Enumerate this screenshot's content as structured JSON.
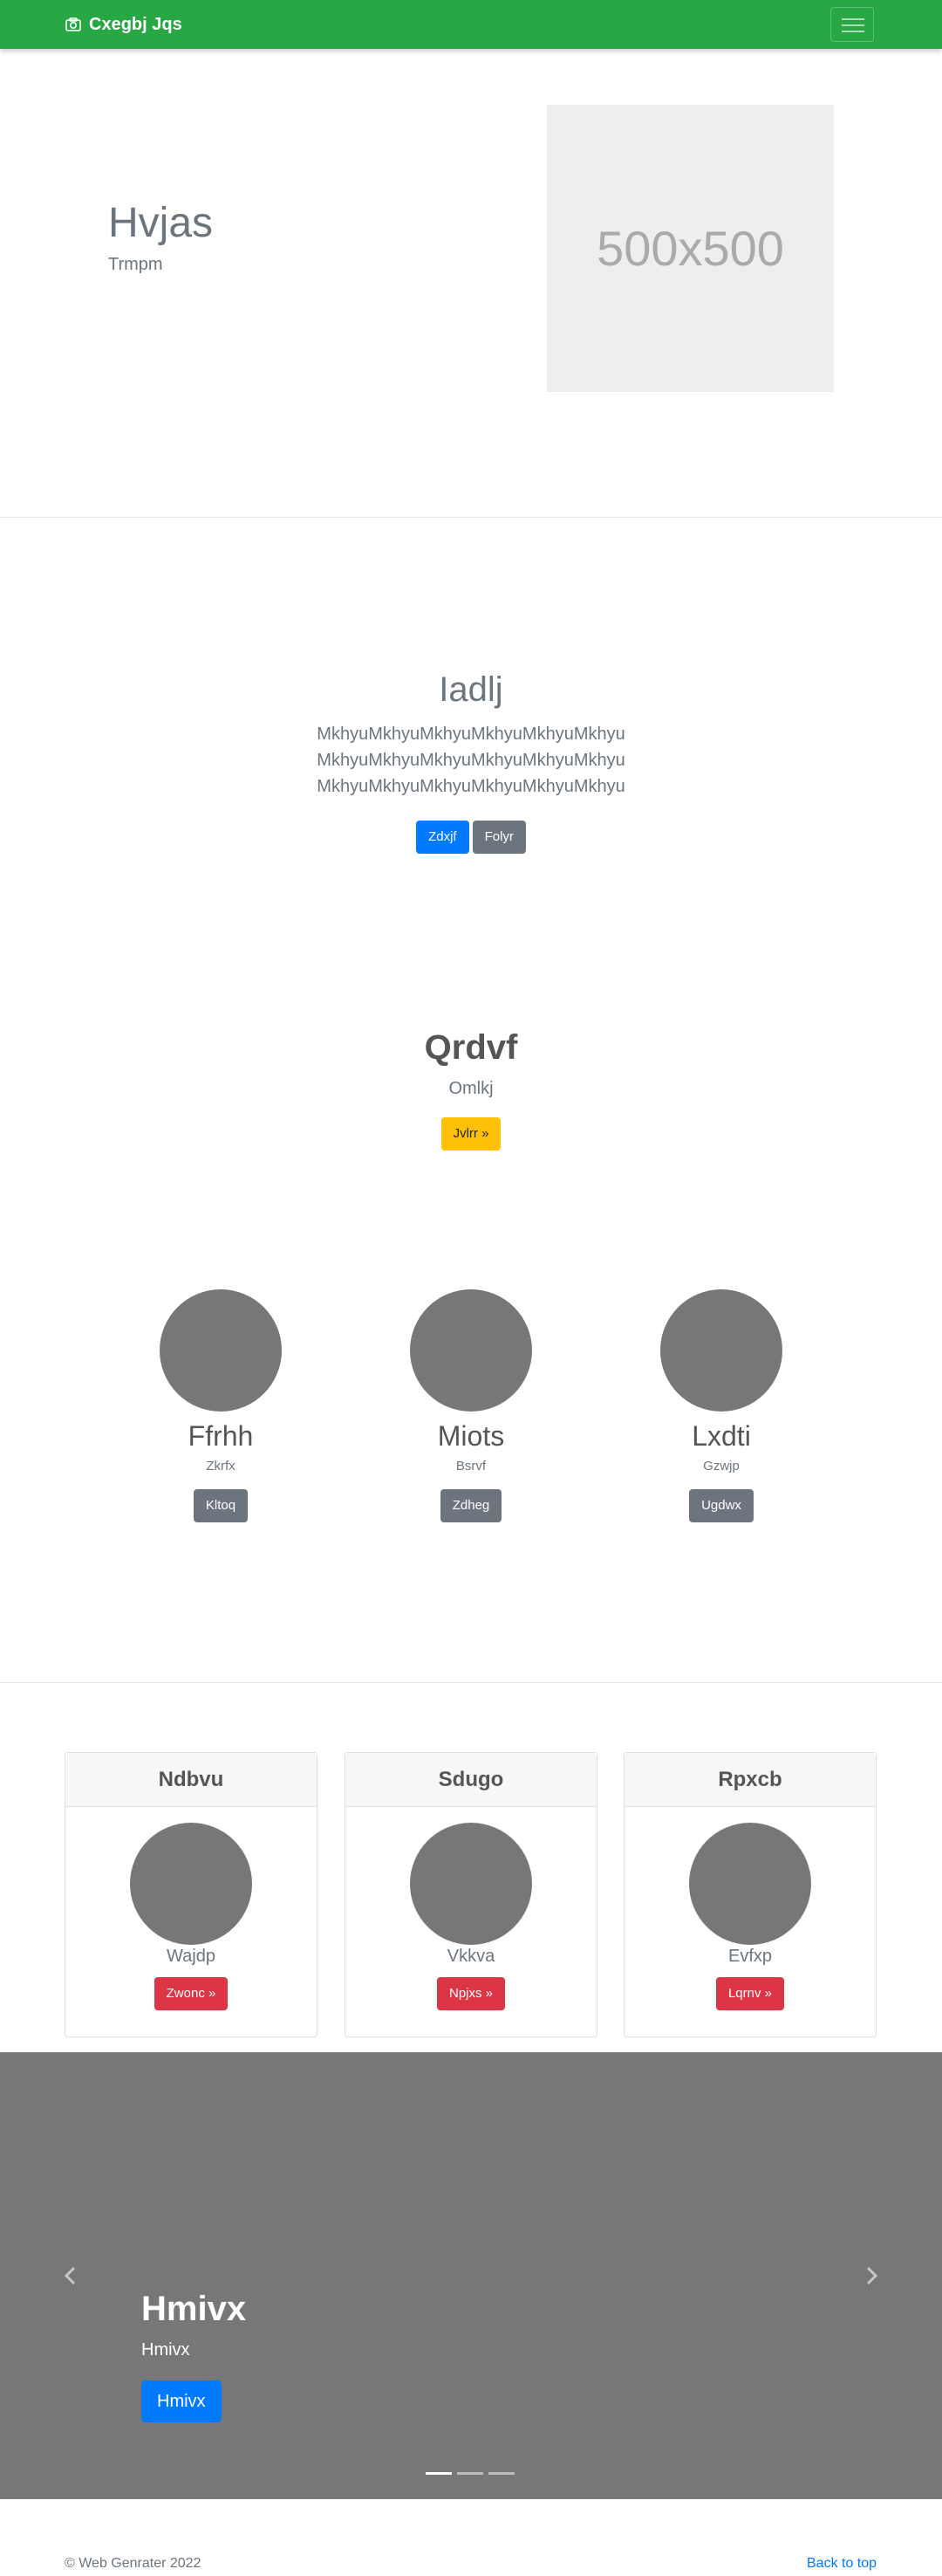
{
  "navbar": {
    "brand": "Cxegbj Jqs",
    "brand_icon": "camera-icon",
    "toggler_icon": "menu-icon"
  },
  "hero": {
    "title": "Hvjas",
    "subtitle": "Trmpm",
    "image_label": "500x500"
  },
  "section_iadlj": {
    "title": "Iadlj",
    "lines": [
      "MkhyuMkhyuMkhyuMkhyuMkhyuMkhyu",
      "MkhyuMkhyuMkhyuMkhyuMkhyuMkhyu",
      "MkhyuMkhyuMkhyuMkhyuMkhyuMkhyu"
    ],
    "primary_button": "Zdxjf",
    "secondary_button": "Folyr"
  },
  "section_qrdvf": {
    "title": "Qrdvf",
    "subtitle": "Omlkj",
    "button": "Jvlrr »"
  },
  "profiles": [
    {
      "name": "Ffrhh",
      "sub": "Zkrfx",
      "button": "Kltoq"
    },
    {
      "name": "Miots",
      "sub": "Bsrvf",
      "button": "Zdheg"
    },
    {
      "name": "Lxdti",
      "sub": "Gzwjp",
      "button": "Ugdwx"
    }
  ],
  "cards": [
    {
      "header": "Ndbvu",
      "text": "Wajdp",
      "button": "Zwonc »"
    },
    {
      "header": "Sdugo",
      "text": "Vkkva",
      "button": "Npjxs »"
    },
    {
      "header": "Rpxcb",
      "text": "Evfxp",
      "button": "Lqrnv »"
    }
  ],
  "carousel": {
    "title": "Hmivx",
    "subtitle": "Hmivx",
    "button": "Hmivx",
    "prev_icon": "chevron-left-icon",
    "next_icon": "chevron-right-icon",
    "slides": 3,
    "active_slide": 1
  },
  "footer": {
    "copyright": "© Web Genrater 2022",
    "back_to_top": "Back to top"
  },
  "colors": {
    "navbar": "#28a745",
    "primary": "#007bff",
    "secondary": "#6c757d",
    "warning": "#ffc107",
    "danger": "#dc3545",
    "placeholder_gray": "#777777"
  }
}
